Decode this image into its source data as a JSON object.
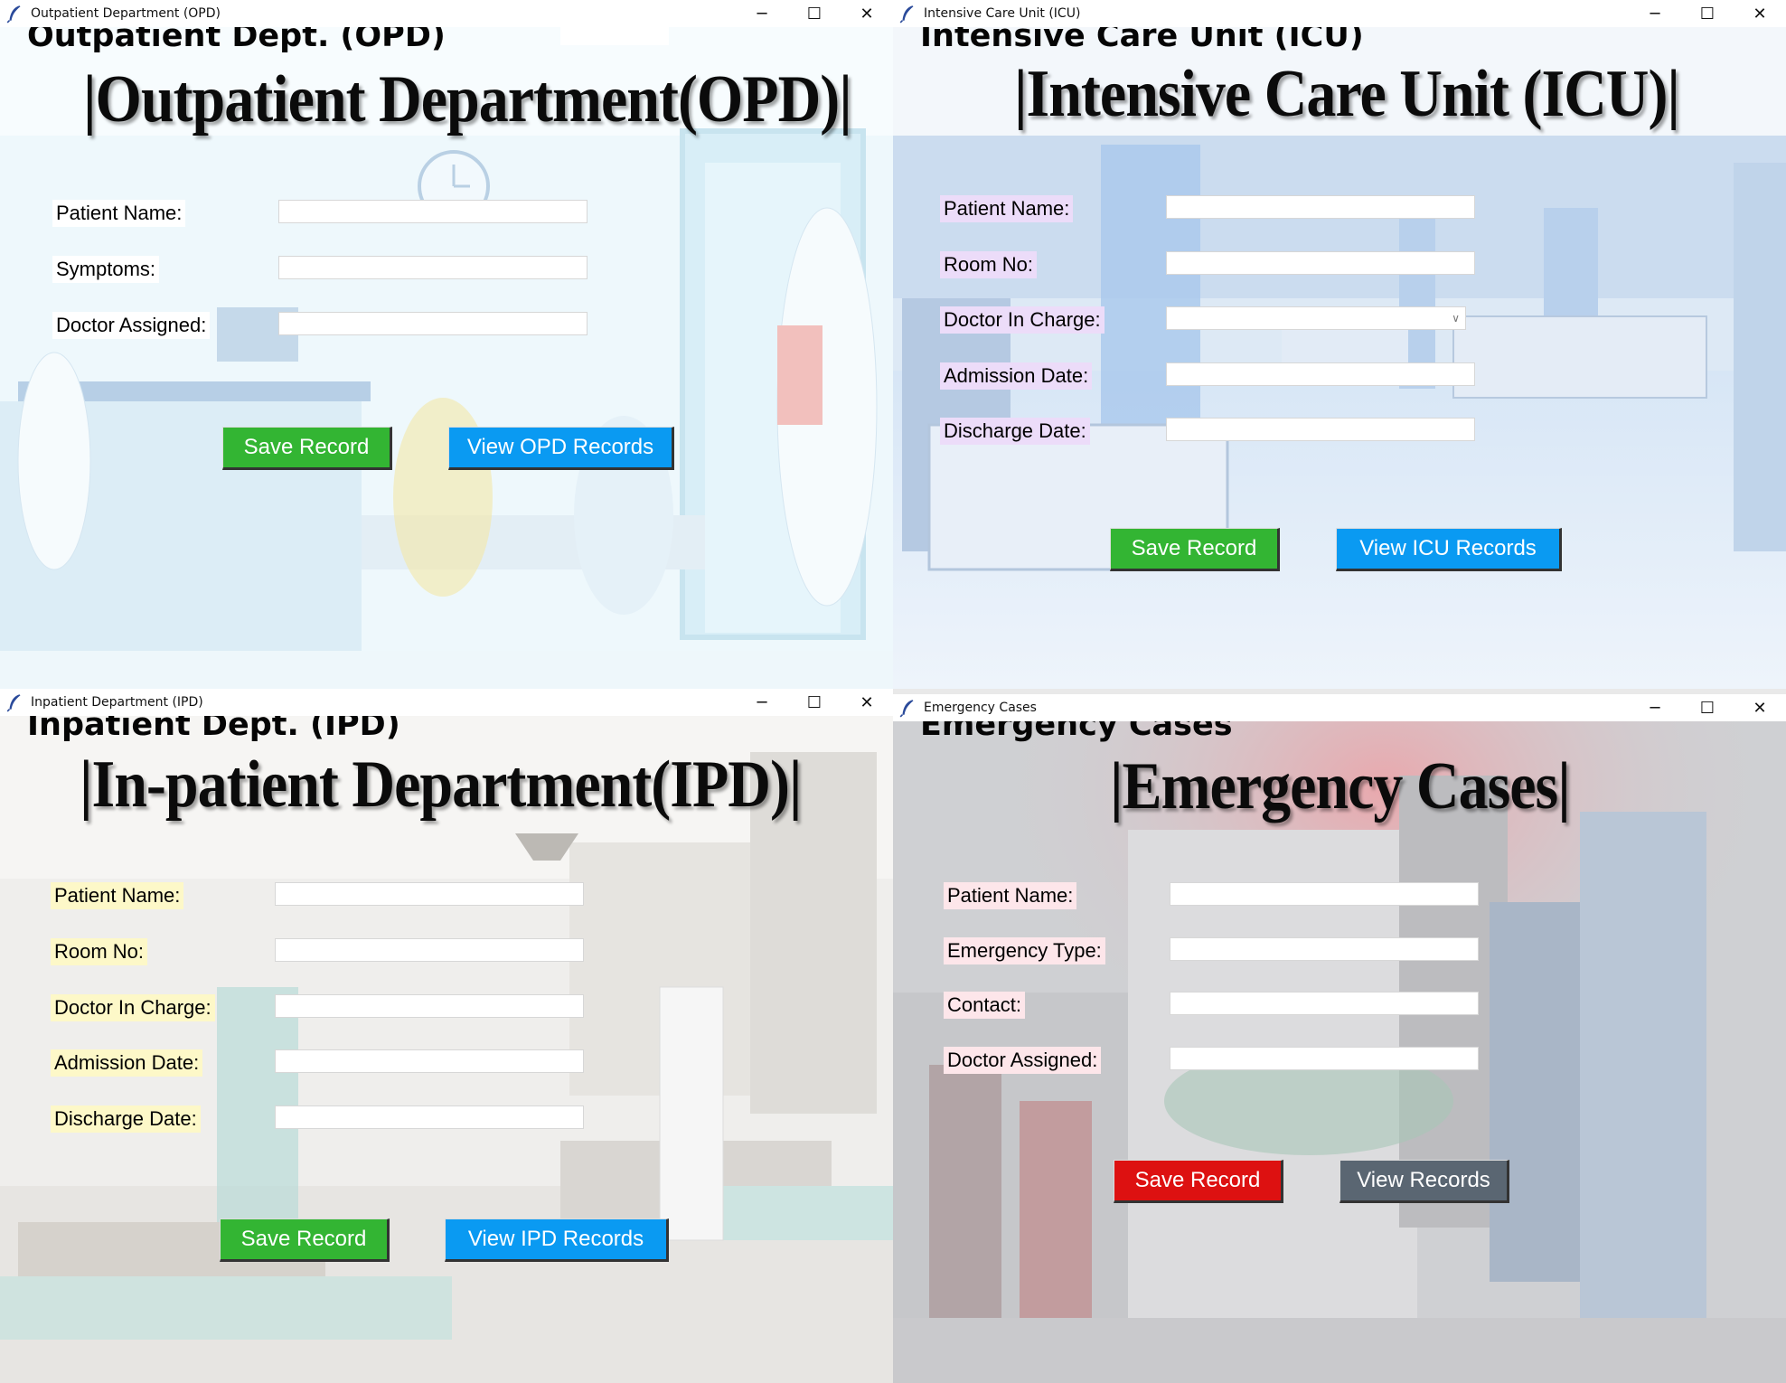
{
  "colors": {
    "save_green": "#33b533",
    "view_blue": "#0a9af2",
    "emergency_red": "#dd1111",
    "view_gray": "#5a6672",
    "label_white_bg": "#ffffff",
    "label_purple_bg": "#ecdcf9",
    "label_yellow_bg": "#fdf8c8",
    "label_pink_bg": "#fde6ea"
  },
  "opd": {
    "window_title": "Outpatient Department (OPD)",
    "heading": "Outpatient Dept. (OPD)",
    "banner": "|Outpatient Department(OPD)|",
    "labels": {
      "patient_name": "Patient Name:",
      "symptoms": "Symptoms:",
      "doctor_assigned": "Doctor Assigned:"
    },
    "values": {
      "patient_name": "",
      "symptoms": "",
      "doctor_assigned": ""
    },
    "buttons": {
      "save": "Save Record",
      "view": "View OPD Records"
    }
  },
  "icu": {
    "window_title": "Intensive Care Unit (ICU)",
    "heading": "Intensive Care Unit (ICU)",
    "banner": "|Intensive Care Unit (ICU)|",
    "labels": {
      "patient_name": "Patient Name:",
      "room_no": "Room No:",
      "doctor_in_charge": "Doctor In Charge:",
      "admission_date": "Admission Date:",
      "discharge_date": "Discharge Date:"
    },
    "values": {
      "patient_name": "",
      "room_no": "",
      "doctor_in_charge": "",
      "admission_date": "",
      "discharge_date": ""
    },
    "buttons": {
      "save": "Save Record",
      "view": "View ICU Records"
    }
  },
  "ipd": {
    "window_title": "Inpatient Department (IPD)",
    "heading": "Inpatient Dept. (IPD)",
    "banner": "|In-patient Department(IPD)|",
    "labels": {
      "patient_name": "Patient Name:",
      "room_no": "Room No:",
      "doctor_in_charge": "Doctor In Charge:",
      "admission_date": "Admission Date:",
      "discharge_date": "Discharge Date:"
    },
    "values": {
      "patient_name": "",
      "room_no": "",
      "doctor_in_charge": "",
      "admission_date": "",
      "discharge_date": ""
    },
    "buttons": {
      "save": "Save Record",
      "view": "View IPD Records"
    }
  },
  "emergency": {
    "window_title": "Emergency Cases",
    "heading": "Emergency Cases",
    "banner": "|Emergency Cases|",
    "labels": {
      "patient_name": "Patient Name:",
      "emergency_type": "Emergency Type:",
      "contact": "Contact:",
      "doctor_assigned": "Doctor Assigned:"
    },
    "values": {
      "patient_name": "",
      "emergency_type": "",
      "contact": "",
      "doctor_assigned": ""
    },
    "buttons": {
      "save": "Save Record",
      "view": "View Records"
    }
  },
  "window_controls": {
    "minimize": "─",
    "maximize": "☐",
    "close": "✕"
  }
}
